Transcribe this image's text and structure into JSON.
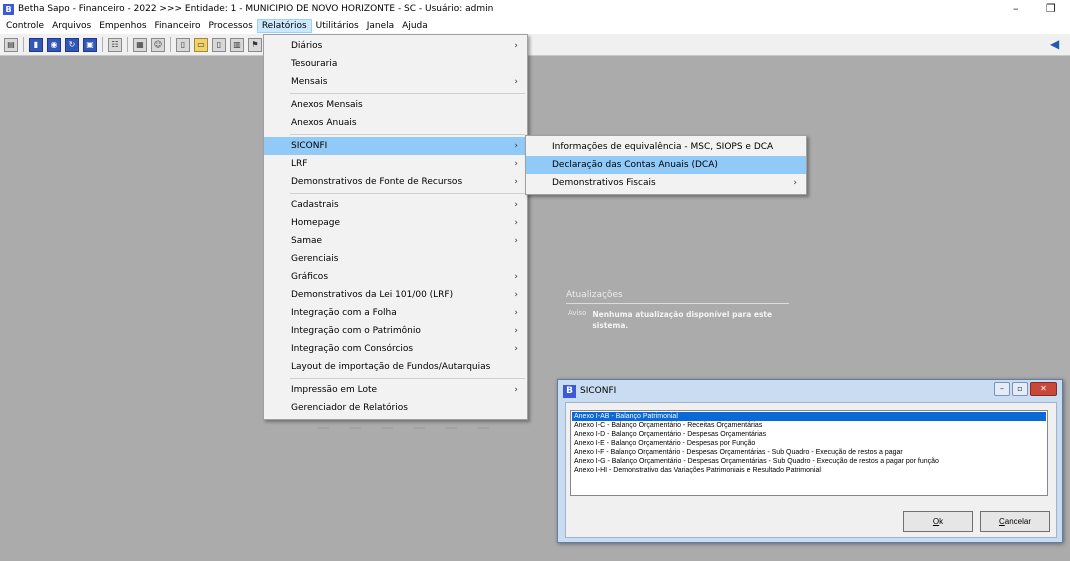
{
  "window": {
    "title": "Betha Sapo - Financeiro - 2022 >>> Entidade: 1 - MUNICIPIO DE NOVO HORIZONTE - SC - Usuário: admin",
    "logo_letter": "B",
    "minimize_glyph": "–",
    "restore_glyph": "❐"
  },
  "menubar": {
    "items": [
      {
        "label": "Controle"
      },
      {
        "label": "Arquivos"
      },
      {
        "label": "Empenhos"
      },
      {
        "label": "Financeiro"
      },
      {
        "label": "Processos"
      },
      {
        "label": "Relatórios"
      },
      {
        "label": "Utilitários"
      },
      {
        "label": "Janela"
      },
      {
        "label": "Ajuda"
      }
    ],
    "active": "Relatórios"
  },
  "toolbar": {
    "icons": [
      "report-icon",
      "book-icon",
      "globe-icon",
      "refresh-icon",
      "disk-icon",
      "org-chart-icon",
      "calc-icon",
      "users-icon",
      "page-icon",
      "folder-icon",
      "document-icon",
      "chart-icon",
      "flag-icon"
    ],
    "announce_icon": "megaphone-icon"
  },
  "relatorios_menu": {
    "items": [
      {
        "label": "Diários",
        "submenu": true
      },
      {
        "label": "Tesouraria",
        "submenu": false
      },
      {
        "label": "Mensais",
        "submenu": true
      },
      {
        "separator": true
      },
      {
        "label": "Anexos Mensais",
        "submenu": false
      },
      {
        "label": "Anexos Anuais",
        "submenu": false
      },
      {
        "separator": true
      },
      {
        "label": "SICONFI",
        "submenu": true,
        "active": true
      },
      {
        "label": "LRF",
        "submenu": true
      },
      {
        "label": "Demonstrativos de Fonte de Recursos",
        "submenu": true
      },
      {
        "separator": true
      },
      {
        "label": "Cadastrais",
        "submenu": true
      },
      {
        "label": "Homepage",
        "submenu": true
      },
      {
        "label": "Samae",
        "submenu": true
      },
      {
        "label": "Gerenciais",
        "submenu": false
      },
      {
        "label": "Gráficos",
        "submenu": true
      },
      {
        "label": "Demonstrativos da Lei 101/00 (LRF)",
        "submenu": true
      },
      {
        "label": "Integração com a Folha",
        "submenu": true
      },
      {
        "label": "Integração com o Patrimônio",
        "submenu": true
      },
      {
        "label": "Integração com Consórcios",
        "submenu": true
      },
      {
        "label": "Layout de importação de Fundos/Autarquias",
        "submenu": false
      },
      {
        "separator": true
      },
      {
        "label": "Impressão em Lote",
        "submenu": true
      },
      {
        "label": "Gerenciador de Relatórios",
        "submenu": false
      }
    ],
    "arrow_glyph": "›"
  },
  "siconfi_submenu": {
    "items": [
      {
        "label": "Informações de equivalência - MSC, SIOPS e DCA",
        "submenu": false
      },
      {
        "label": "Declaração das Contas Anuais (DCA)",
        "submenu": false,
        "active": true
      },
      {
        "label": "Demonstrativos Fiscais",
        "submenu": true
      }
    ]
  },
  "updates": {
    "title": "Atualizações",
    "label": "Aviso",
    "text": "Nenhuma atualização disponível para este sistema."
  },
  "dialog": {
    "title": "SICONFI",
    "logo_letter": "B",
    "controls": {
      "minimize": "–",
      "maximize": "▫",
      "close": "✕"
    },
    "list": [
      {
        "label": "Anexo I-AB - Balanço Patrimonial",
        "selected": true
      },
      {
        "label": "Anexo I-C - Balanço Orçamentário - Receitas Orçamentárias"
      },
      {
        "label": "Anexo I-D - Balanço Orçamentário - Despesas Orçamentárias"
      },
      {
        "label": "Anexo I-E - Balanço Orçamentário - Despesas por Função"
      },
      {
        "label": "Anexo I-F - Balanço Orçamentário - Despesas Orçamentárias - Sub Quadro - Execução de restos a pagar"
      },
      {
        "label": "Anexo I-G - Balanço Orçamentário - Despesas Orçamentárias - Sub Quadro - Execução de restos a pagar por função"
      },
      {
        "label": "Anexo I-HI - Demonstrativo das Variações Patrimoniais e Resultado Patrimonial"
      }
    ],
    "ok_accel": "O",
    "ok_rest": "k",
    "cancel_accel": "C",
    "cancel_rest": "ancelar"
  }
}
